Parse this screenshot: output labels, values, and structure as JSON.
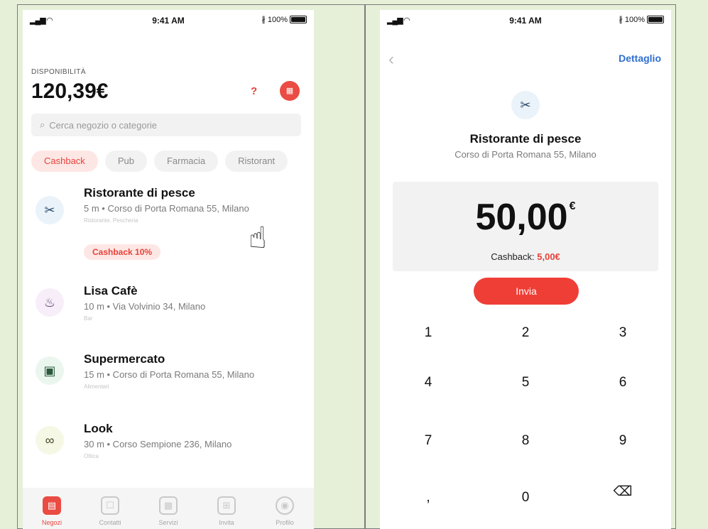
{
  "left": {
    "status": {
      "time": "9:41 AM",
      "battery": "100%"
    },
    "header": {
      "avail_label": "DISPONIBILITÀ",
      "balance": "120,39€",
      "help": "?"
    },
    "search": {
      "placeholder": "Cerca negozio o categorie"
    },
    "chips": [
      "Cashback",
      "Pub",
      "Farmacia",
      "Ristorant"
    ],
    "stores": [
      {
        "name": "Ristorante di pesce",
        "address": "5 m • Corso di Porta Romana 55, Milano",
        "category": "Ristorante, Pescheria",
        "badge": "Cashback 10%"
      },
      {
        "name": "Lisa Cafè",
        "address": "10 m • Via Volvinio 34, Milano",
        "category": "Bar"
      },
      {
        "name": "Supermercato",
        "address": "15 m • Corso di Porta Romana 55, Milano",
        "category": "Alimentari"
      },
      {
        "name": "Look",
        "address": "30 m • Corso Sempione 236, Milano",
        "category": "Ottica"
      }
    ],
    "tabs": [
      "Negozi",
      "Contatti",
      "Servizi",
      "Invita",
      "Profilo"
    ]
  },
  "right": {
    "status": {
      "time": "9:41 AM",
      "battery": "100%"
    },
    "nav": {
      "detail": "Dettaglio"
    },
    "store": {
      "name": "Ristorante di pesce",
      "address": "Corso di Porta Romana 55, Milano"
    },
    "amount": {
      "value": "50,00",
      "currency": "€",
      "cashback_label": "Cashback:",
      "cashback_value": "5,00€"
    },
    "send_label": "Invia",
    "keys": [
      "1",
      "2",
      "3",
      "4",
      "5",
      "6",
      "7",
      "8",
      "9",
      ",",
      "0",
      "⌫"
    ]
  },
  "colors": {
    "accent": "#e8423b",
    "link": "#2f6ed0",
    "background": "#e6f0d8"
  }
}
